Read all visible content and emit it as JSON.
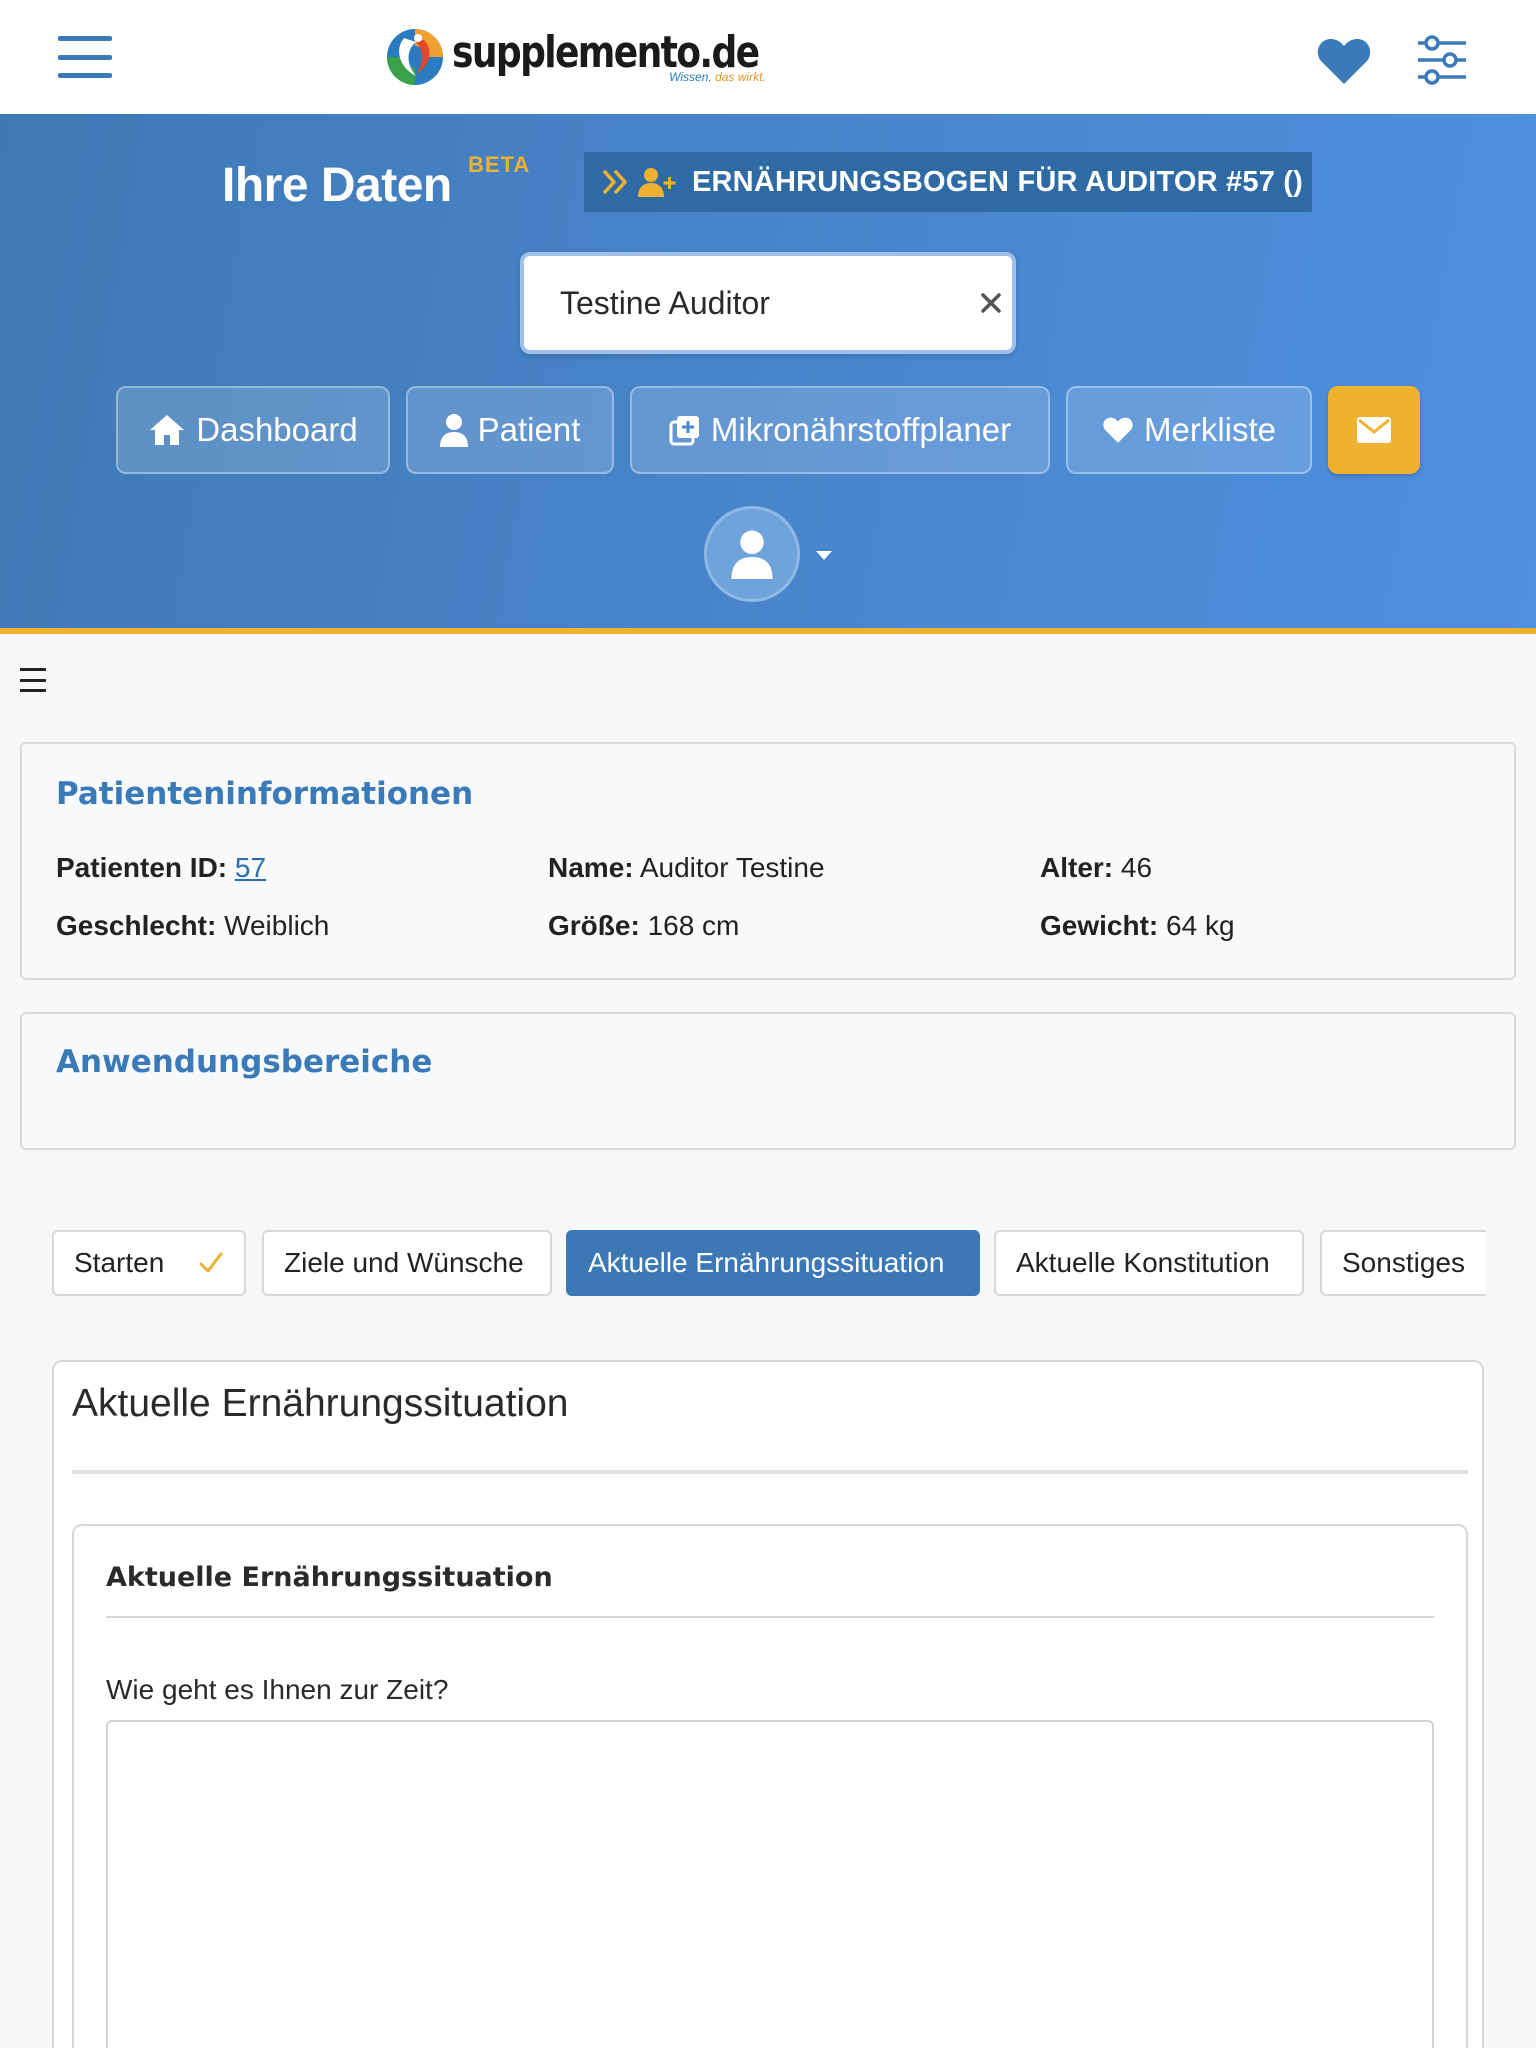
{
  "header": {
    "logo_name": "supplemento.de",
    "logo_tag_1": "Wissen, ",
    "logo_tag_2": "das wirkt."
  },
  "hero": {
    "title": "Ihre Daten",
    "beta": "BETA",
    "bogen_label": "ERNÄHRUNGSBOGEN FÜR AUDITOR #57 ()",
    "search_value": "Testine Auditor",
    "nav": {
      "dashboard": "Dashboard",
      "patient": "Patient",
      "mikro": "Mikronährstoffplaner",
      "merkliste": "Merkliste"
    }
  },
  "patient_info": {
    "title": "Patienteninformationen",
    "id_label": "Patienten ID:",
    "id_value": "57",
    "name_label": "Name:",
    "name_value": "Auditor Testine",
    "age_label": "Alter:",
    "age_value": "46",
    "gender_label": "Geschlecht:",
    "gender_value": "Weiblich",
    "height_label": "Größe:",
    "height_value": "168 cm",
    "weight_label": "Gewicht:",
    "weight_value": "64 kg"
  },
  "areas": {
    "title": "Anwendungsbereiche"
  },
  "tabs": [
    {
      "label": "Starten",
      "done": true
    },
    {
      "label": "Ziele und Wünsche"
    },
    {
      "label": "Aktuelle Ernährungssituation",
      "active": true
    },
    {
      "label": "Aktuelle Konstitution"
    },
    {
      "label": "Sonstiges"
    }
  ],
  "section": {
    "title": "Aktuelle Ernährungssituation",
    "inner_title": "Aktuelle Ernährungssituation",
    "question": "Wie geht es Ihnen zur Zeit?",
    "answer": ""
  },
  "colors": {
    "accent_blue": "#3b78b5",
    "accent_orange": "#f0b030"
  },
  "icons": [
    "hamburger-icon",
    "heart-icon",
    "filter-sliders-icon",
    "double-chevron-right-icon",
    "user-plus-icon",
    "search-icon",
    "close-icon",
    "home-icon",
    "user-icon",
    "plus-square-icon",
    "envelope-icon",
    "caret-down-icon",
    "check-icon"
  ]
}
